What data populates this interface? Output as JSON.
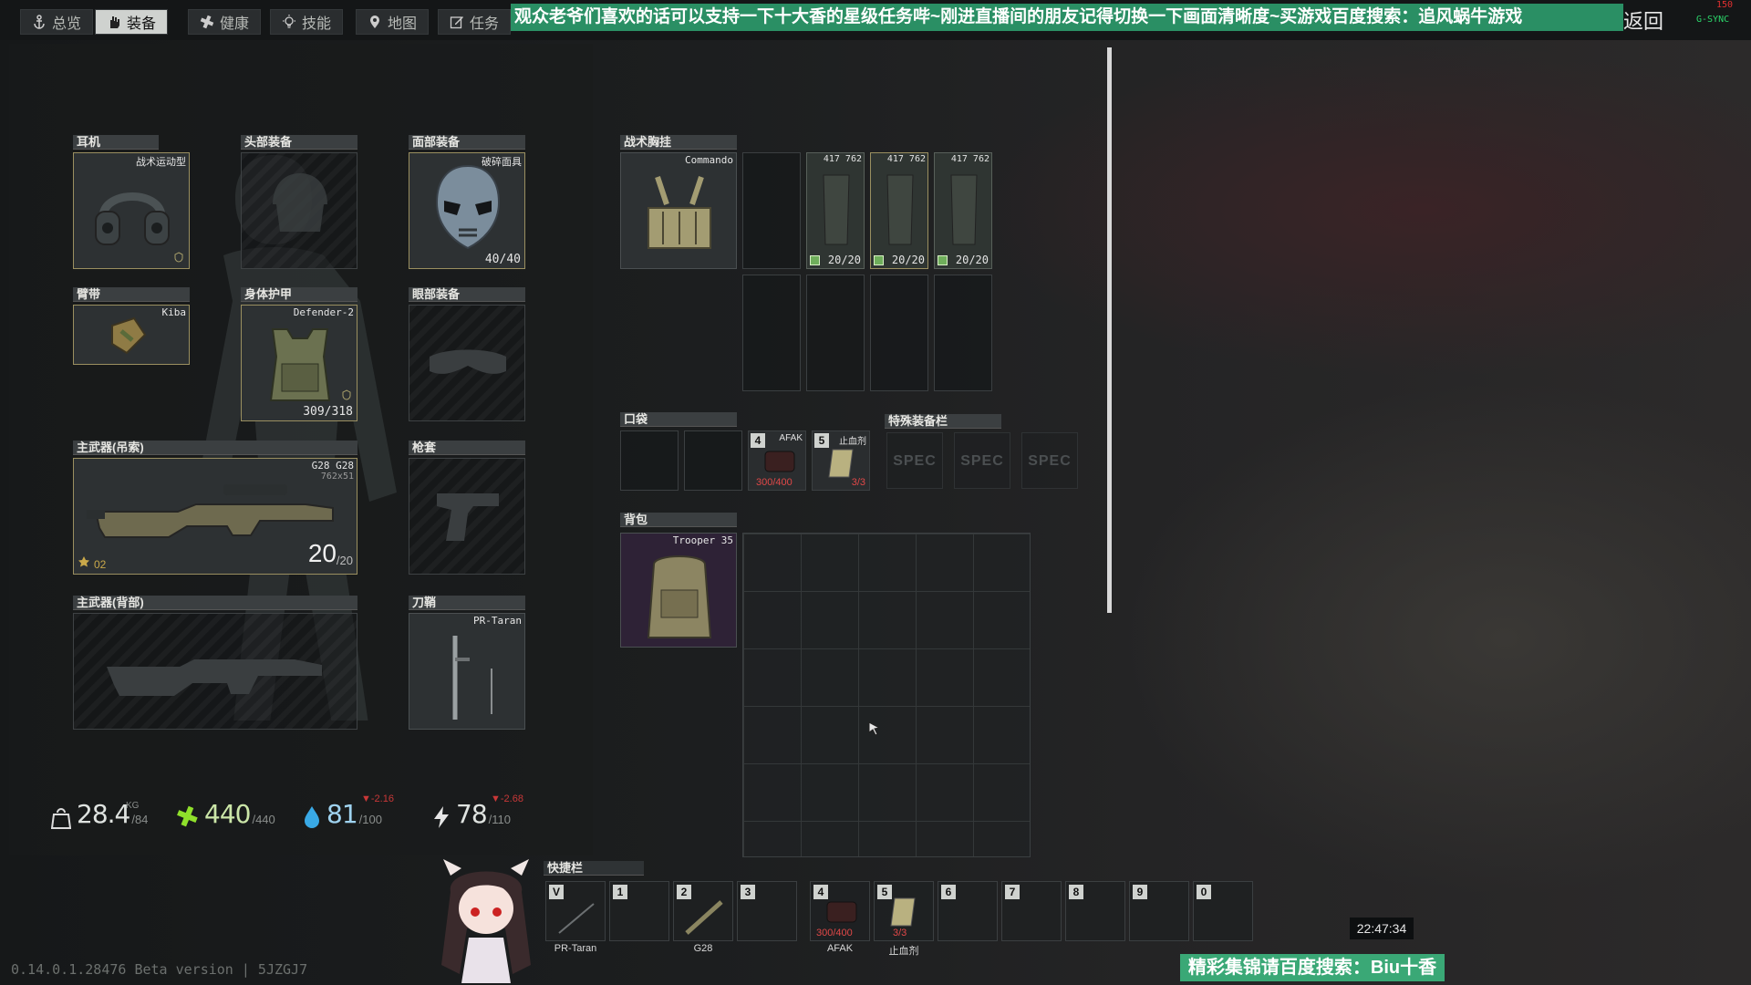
{
  "tabs": [
    {
      "label": "总览"
    },
    {
      "label": "装备"
    },
    {
      "label": "健康"
    },
    {
      "label": "技能"
    },
    {
      "label": "地图"
    },
    {
      "label": "任务"
    }
  ],
  "banner": "观众老爷们喜欢的话可以支持一下十大香的星级任务哔~刚进直播间的朋友记得切换一下画面清晰度~买游戏百度搜索：追风蜗牛游戏",
  "back": "返回",
  "fps": {
    "label": "G-SYNC",
    "value": "150"
  },
  "slots": {
    "earpiece": {
      "label": "耳机",
      "item": "战术运动型"
    },
    "headwear": {
      "label": "头部装备"
    },
    "facecover": {
      "label": "面部装备",
      "item": "破碎面具",
      "durability": "40/40"
    },
    "armband": {
      "label": "臂带",
      "item": "Kiba"
    },
    "armor": {
      "label": "身体护甲",
      "item": "Defender-2",
      "durability": "309/318"
    },
    "eyewear": {
      "label": "眼部装备"
    },
    "primary": {
      "label": "主武器(吊索)",
      "item": "G28 G28",
      "caliber": "762x51",
      "ammo": "20",
      "ammo_max": "/20",
      "mastery": "02"
    },
    "holster": {
      "label": "枪套"
    },
    "primary2": {
      "label": "主武器(背部)"
    },
    "scabbard": {
      "label": "刀鞘",
      "item": "PR-Taran"
    },
    "rig": {
      "label": "战术胸挂",
      "item": "Commando"
    },
    "pockets": {
      "label": "口袋"
    },
    "special": {
      "label": "特殊装备栏",
      "spec": "SPEC"
    },
    "backpack": {
      "label": "背包",
      "item": "Trooper 35"
    }
  },
  "mags": [
    {
      "cap": "417 762",
      "ammo": "20/20"
    },
    {
      "cap": "417 762",
      "ammo": "20/20"
    },
    {
      "cap": "417 762",
      "ammo": "20/20"
    }
  ],
  "pocket_items": [
    {
      "key": "4",
      "name": "AFAK",
      "value": "300/400"
    },
    {
      "key": "5",
      "name": "止血剂",
      "value": "3/3"
    }
  ],
  "stats": {
    "weight": {
      "value": "28.4",
      "unit": "KG",
      "max": "/84"
    },
    "health": {
      "value": "440",
      "max": "/440"
    },
    "hydration": {
      "value": "81",
      "max": "/100",
      "delta": "▼-2.16"
    },
    "energy": {
      "value": "78",
      "max": "/110",
      "delta": "▼-2.68"
    }
  },
  "quickbar": {
    "label": "快捷栏",
    "slots": [
      {
        "key": "V",
        "label": "PR-Taran"
      },
      {
        "key": "1",
        "label": ""
      },
      {
        "key": "2",
        "label": "G28"
      },
      {
        "key": "3",
        "label": ""
      },
      {
        "key": "4",
        "label": "AFAK",
        "sub": "300/400"
      },
      {
        "key": "5",
        "label": "止血剂",
        "sub": "3/3"
      },
      {
        "key": "6",
        "label": ""
      },
      {
        "key": "7",
        "label": ""
      },
      {
        "key": "8",
        "label": ""
      },
      {
        "key": "9",
        "label": ""
      },
      {
        "key": "0",
        "label": ""
      }
    ]
  },
  "clock": "22:47:34",
  "footer_banner": "精彩集锦请百度搜索：Biu十香",
  "version": "0.14.0.1.28476 Beta version | 5JZGJ7",
  "colors": {
    "banner": "#2a8f64",
    "accent": "#9a8f60",
    "negative": "#c93838",
    "health": "#8fe02b",
    "water": "#39a9e6"
  }
}
